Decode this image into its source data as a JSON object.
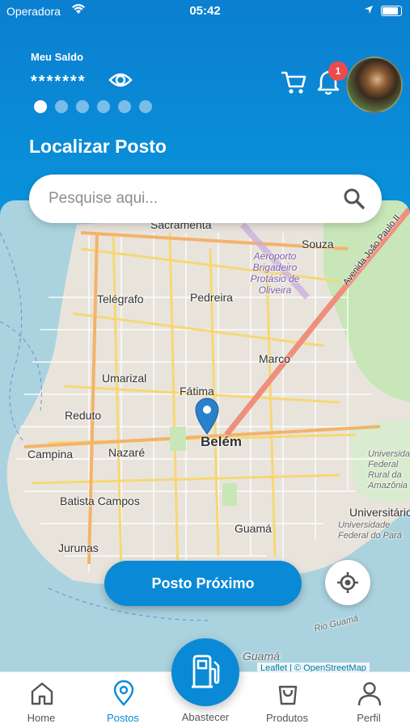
{
  "status": {
    "carrier": "Operadora",
    "time": "05:42"
  },
  "balance": {
    "label": "Meu Saldo",
    "value": "*******"
  },
  "carousel": {
    "total": 6,
    "active": 0
  },
  "notifications": {
    "count": "1"
  },
  "page": {
    "title": "Localizar Posto"
  },
  "search": {
    "placeholder": "Pesquise aqui..."
  },
  "map": {
    "labels": {
      "sacramenta": "Sacramenta",
      "souza": "Souza",
      "aeroporto": "Aeroporto Brigadeiro Protásio de Oliveira",
      "avenida": "Avenida João Paulo II",
      "telegrafo": "Telégrafo",
      "pedreira": "Pedreira",
      "marco": "Marco",
      "umarizal": "Umarizal",
      "fatima": "Fátima",
      "reduto": "Reduto",
      "belem": "Belém",
      "campina": "Campina",
      "nazare": "Nazaré",
      "ufra": "Universidade Federal Rural da Amazônia",
      "batista": "Batista Campos",
      "universitario": "Universitário",
      "ufpa": "Universidade Federal do Pará",
      "guama": "Guamá",
      "jurunas": "Jurunas",
      "rio_guama": "Rio Guamá",
      "guama_water": "Guamá"
    },
    "attribution": "Leaflet | © OpenStreetMap"
  },
  "actions": {
    "nearest": "Posto Próximo"
  },
  "tabs": {
    "home": "Home",
    "postos": "Postos",
    "abastecer": "Abastecer",
    "produtos": "Produtos",
    "perfil": "Perfil"
  },
  "colors": {
    "primary": "#0a8ad6",
    "badge": "#ef4a4a",
    "water": "#aad3df"
  }
}
